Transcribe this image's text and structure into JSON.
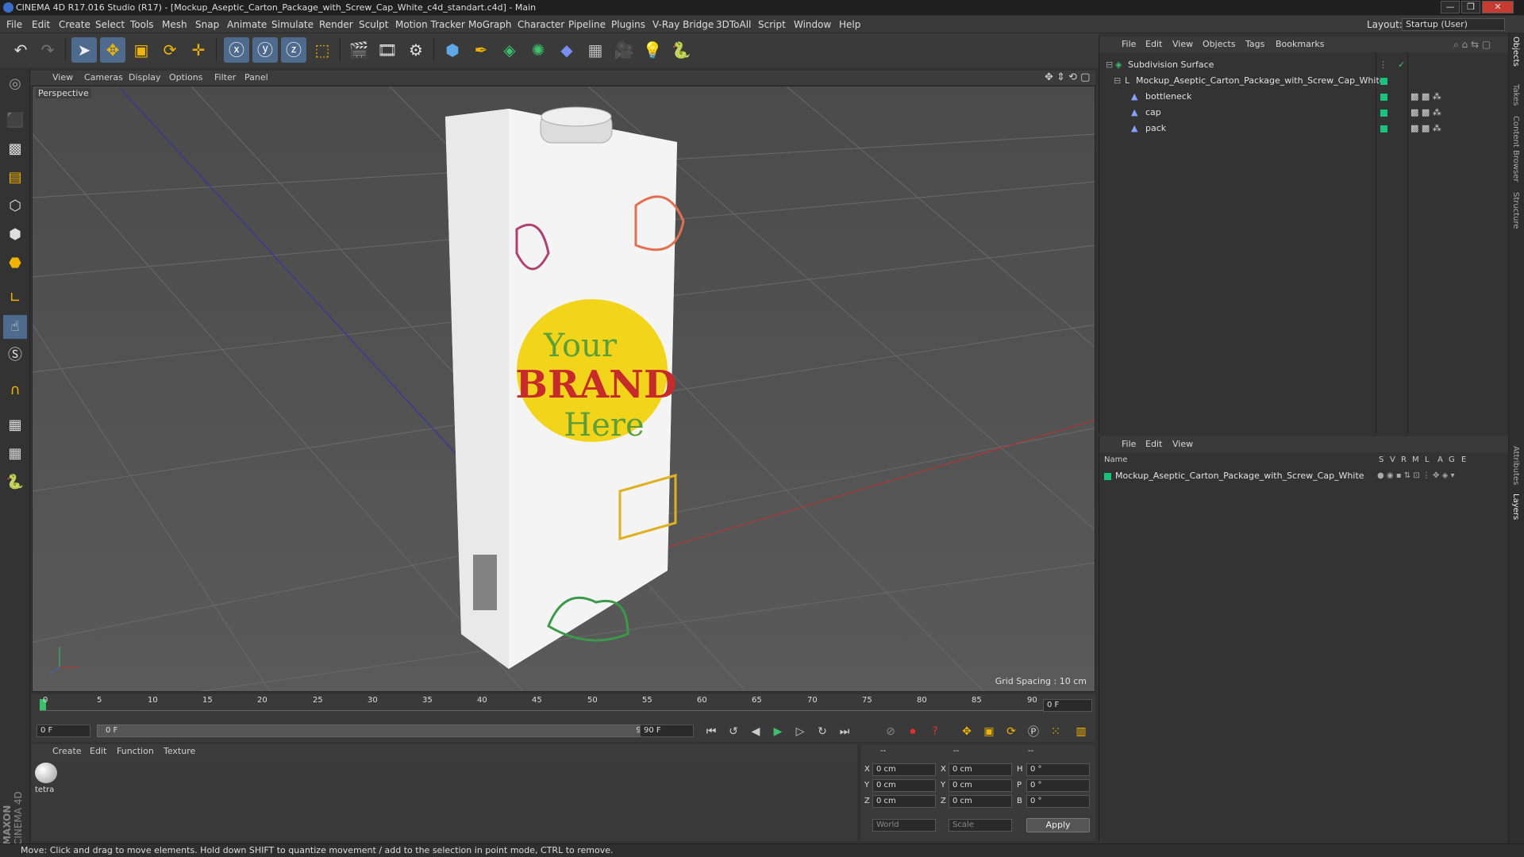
{
  "window": {
    "title": "CINEMA 4D R17.016 Studio (R17) - [Mockup_Aseptic_Carton_Package_with_Screw_Cap_White_c4d_standart.c4d] - Main",
    "min": "—",
    "max": "❐",
    "close": "✕"
  },
  "menu": {
    "items": [
      "File",
      "Edit",
      "Create",
      "Select",
      "Tools",
      "Mesh",
      "Snap",
      "Animate",
      "Simulate",
      "Render",
      "Sculpt",
      "Motion Tracker",
      "MoGraph",
      "Character",
      "Pipeline",
      "Plugins",
      "V-Ray Bridge",
      "3DToAll",
      "Script",
      "Window",
      "Help"
    ],
    "layout_label": "Layout:",
    "layout_value": "Startup (User)"
  },
  "viewport": {
    "menu": [
      "View",
      "Cameras",
      "Display",
      "Options",
      "Filter",
      "Panel"
    ],
    "label": "Perspective",
    "grid_spacing": "Grid Spacing : 10 cm",
    "brand_line1": "Your",
    "brand_line2": "BRAND",
    "brand_line3": "Here"
  },
  "timeline": {
    "ticks": [
      "0",
      "5",
      "10",
      "15",
      "20",
      "25",
      "30",
      "35",
      "40",
      "45",
      "50",
      "55",
      "60",
      "65",
      "70",
      "75",
      "80",
      "85",
      "90"
    ],
    "frame_field": "0 F",
    "start_field": "0 F",
    "range_start": "0 F",
    "range_end": "90 F",
    "end_field": "90 F"
  },
  "material": {
    "menu": [
      "Create",
      "Edit",
      "Function",
      "Texture"
    ],
    "swatch_label": "tetra"
  },
  "coords": {
    "header": [
      "--",
      "--",
      "--"
    ],
    "rows": [
      {
        "l1": "X",
        "v1": "0 cm",
        "l2": "X",
        "v2": "0 cm",
        "l3": "H",
        "v3": "0 °"
      },
      {
        "l1": "Y",
        "v1": "0 cm",
        "l2": "Y",
        "v2": "0 cm",
        "l3": "P",
        "v3": "0 °"
      },
      {
        "l1": "Z",
        "v1": "0 cm",
        "l2": "Z",
        "v2": "0 cm",
        "l3": "B",
        "v3": "0 °"
      }
    ],
    "world": "World",
    "scale": "Scale",
    "apply": "Apply"
  },
  "objects": {
    "menu": [
      "File",
      "Edit",
      "View",
      "Objects",
      "Tags",
      "Bookmarks"
    ],
    "items": [
      {
        "name": "Subdivision Surface"
      },
      {
        "name": "Mockup_Aseptic_Carton_Package_with_Screw_Cap_White"
      },
      {
        "name": "bottleneck"
      },
      {
        "name": "cap"
      },
      {
        "name": "pack"
      }
    ]
  },
  "layers": {
    "menu": [
      "File",
      "Edit",
      "View"
    ],
    "col_name": "Name",
    "cols": [
      "S",
      "V",
      "R",
      "M",
      "L",
      "A",
      "G",
      "E"
    ],
    "item": "Mockup_Aseptic_Carton_Package_with_Screw_Cap_White"
  },
  "right_tabs": [
    "Objects",
    "Takes",
    "Content Browser",
    "Structure",
    "Attributes",
    "Layers"
  ],
  "brand": {
    "logo_line1": "MAXON",
    "logo_line2": "CINEMA 4D"
  },
  "status": "Move: Click and drag to move elements. Hold down SHIFT to quantize movement / add to the selection in point mode, CTRL to remove.",
  "colors": {
    "accent": "#19c27a",
    "x_axis": "#c03030",
    "z_axis": "#3030b0",
    "brand_yellow": "#f2d51a",
    "brand_red": "#c72a2a",
    "brand_green": "#5e9e3a"
  }
}
